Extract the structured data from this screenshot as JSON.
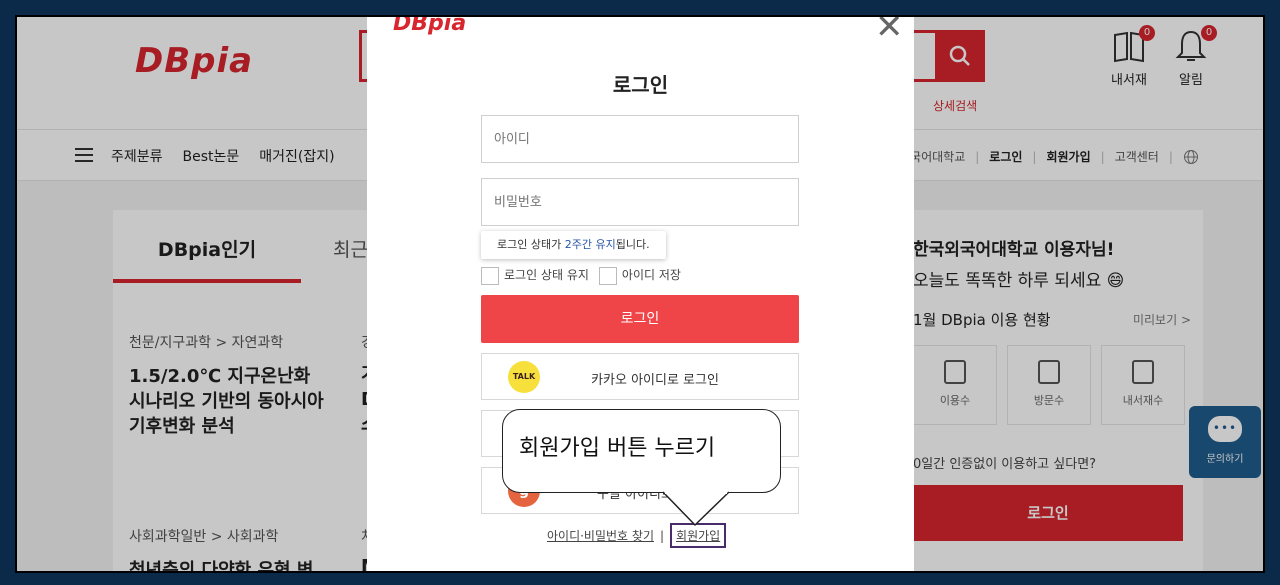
{
  "header": {
    "logo": "DBpia",
    "detail_search": "상세검색",
    "library": {
      "label": "내서재",
      "count": "0"
    },
    "notifications": {
      "label": "알림",
      "count": "0"
    }
  },
  "nav": {
    "items": [
      "주제분류",
      "Best논문",
      "매거진(잡지)"
    ],
    "right": {
      "institution": "외국어대학교",
      "login": "로그인",
      "signup": "회원가입",
      "support": "고객센터"
    }
  },
  "main": {
    "tab_active": "DBpia인기",
    "tab_other": "최근",
    "articles": [
      {
        "category": "천문/지구과학 > 자연과학",
        "title": "1.5/2.0℃ 지구온난화 시나리오 기반의 동아시아 기후변화 분석"
      },
      {
        "category": "사회과학일반 > 사회과학",
        "title": "청년층의 다양한 유형 변"
      }
    ],
    "partial_texts": [
      "경",
      "기",
      "D",
      "스",
      "처",
      "M"
    ]
  },
  "right_panel": {
    "greeting": "한국외국어대학교 이용자님!",
    "subtitle": "오늘도 똑똑한 하루 되세요",
    "emoji": "😄",
    "stats_title": "1월 DBpia 이용 현황",
    "preview": "미리보기 >",
    "stats": [
      "이용수",
      "방문수",
      "내서재수"
    ],
    "trial_text": "0일간 인증없이 이용하고 싶다면?",
    "login": "로그인"
  },
  "chat": {
    "label": "문의하기"
  },
  "modal": {
    "logo": "DBpia",
    "close": "✕",
    "title": "로그인",
    "id_placeholder": "아이디",
    "pw_placeholder": "비밀번호",
    "tooltip": {
      "before": "로그인 상태가 ",
      "highlight": "2주간 유지",
      "after": "됩니다."
    },
    "keep_login": "로그인 상태 유지",
    "save_id": "아이디 저장",
    "login_button": "로그인",
    "kakao": {
      "icon_text": "TALK",
      "label": "카카오 아이디로 로그인"
    },
    "google": {
      "icon_text": "g",
      "label": "구글 아이디로 로그인"
    },
    "find_link": "아이디·비밀번호 찾기",
    "divider": "|",
    "signup_link": "회원가입"
  },
  "annotation": {
    "text": "회원가입 버튼 누르기"
  }
}
